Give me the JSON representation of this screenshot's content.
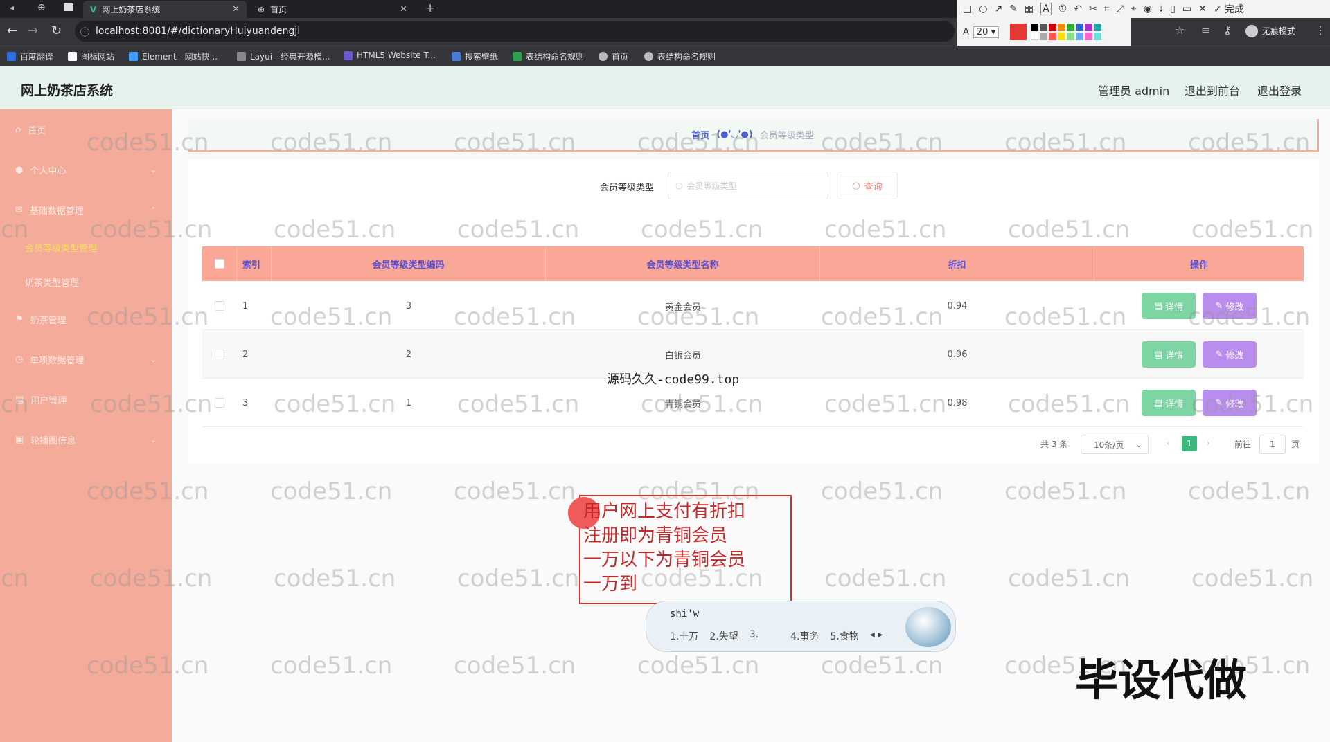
{
  "browser": {
    "tabs": [
      {
        "label": "网上奶茶店系统"
      },
      {
        "label": "首页"
      }
    ],
    "url": "localhost:8081/#/dictionaryHuiyuandengji",
    "bookmarks": [
      "百度翻译",
      "图标网站",
      "Element - 网站快...",
      "Layui - 经典开源模...",
      "HTML5 Website T...",
      "搜索壁纸",
      "表结构命名规则",
      "首页",
      "表结构命名规则"
    ],
    "incognito_label": "无痕模式"
  },
  "annotation_toolbar": {
    "done_label": "完成",
    "font_size": "20"
  },
  "header": {
    "title": "网上奶茶店系统",
    "admin_label": "管理员 admin",
    "frontend_label": "退出到前台",
    "logout_label": "退出登录"
  },
  "sidebar": {
    "items": [
      {
        "label": "首页",
        "icon": "home-icon"
      },
      {
        "label": "个人中心",
        "icon": "user-icon"
      },
      {
        "label": "基础数据管理",
        "icon": "mail-icon"
      },
      {
        "label": "会员等级类型管理",
        "icon": "none"
      },
      {
        "label": "奶茶类型管理",
        "icon": "none"
      },
      {
        "label": "奶茶管理",
        "icon": "flag-icon"
      },
      {
        "label": "单项数据管理",
        "icon": "clock-icon"
      },
      {
        "label": "用户管理",
        "icon": "user-list-icon"
      },
      {
        "label": "轮播图信息",
        "icon": "image-icon"
      }
    ]
  },
  "breadcrumb": {
    "home": "首页",
    "face": "(●'◡'●)",
    "current": "会员等级类型"
  },
  "search": {
    "label": "会员等级类型",
    "placeholder": "会员等级类型",
    "button": "查询"
  },
  "table": {
    "headers": [
      "索引",
      "会员等级类型编码",
      "会员等级类型名称",
      "折扣",
      "操作"
    ],
    "rows": [
      {
        "index": "1",
        "code": "3",
        "name": "黄金会员",
        "discount": "0.94"
      },
      {
        "index": "2",
        "code": "2",
        "name": "白银会员",
        "discount": "0.96"
      },
      {
        "index": "3",
        "code": "1",
        "name": "青铜会员",
        "discount": "0.98"
      }
    ],
    "detail_label": "详情",
    "edit_label": "修改"
  },
  "pagination": {
    "total": "共 3 条",
    "page_size": "10条/页",
    "current": "1",
    "goto_label": "前往",
    "goto_value": "1",
    "page_unit": "页"
  },
  "watermark": "code51.cn",
  "center_watermark": "源码久久-code99.top",
  "note": {
    "text": "用户网上支付有折扣\n注册即为青铜会员\n一万以下为青铜会员\n一万到"
  },
  "ime": {
    "input": "shi'w",
    "candidates": [
      "1.十万",
      "2.失望",
      "3.",
      "4.事务",
      "5.食物"
    ]
  },
  "overlay_text": "毕设代做",
  "colors": {
    "sidebar": "#f5ab99",
    "table_header": "#f9a898",
    "detail": "#7dd5a4",
    "edit": "#b98ded",
    "accent": "#3db87c"
  }
}
